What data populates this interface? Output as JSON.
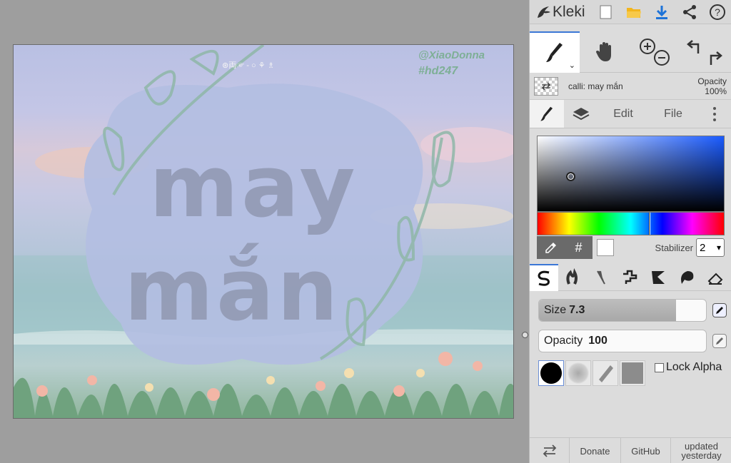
{
  "app": {
    "name": "Kleki"
  },
  "toolbar_top": {
    "icons": [
      "new-file-icon",
      "open-folder-icon",
      "download-icon",
      "share-icon",
      "help-icon"
    ]
  },
  "canvas": {
    "watermark_handle": "@XiaoDonna",
    "watermark_tag": "#hd247",
    "title_line1": "may",
    "title_line2": "mắn",
    "header_small": "⊛両☞ - ○ ⚘ ♗"
  },
  "layer": {
    "name": "calli: may mắn",
    "opacity_label": "Opacity",
    "opacity_value": "100%"
  },
  "tabs": {
    "edit": "Edit",
    "file": "File"
  },
  "color": {
    "hex_symbol": "#",
    "current": "#ffffff",
    "hue_accent": "#1a5bff"
  },
  "stabilizer": {
    "label": "Stabilizer",
    "value": "2"
  },
  "brush": {
    "size_label": "Size",
    "size_value": "7.3",
    "size_fraction": 0.82,
    "opacity_label": "Opacity",
    "opacity_value": "100",
    "opacity_fraction": 0.0
  },
  "lock_alpha": {
    "label": "Lock Alpha"
  },
  "footer": {
    "donate": "Donate",
    "github": "GitHub",
    "updated": "updated yesterday"
  }
}
